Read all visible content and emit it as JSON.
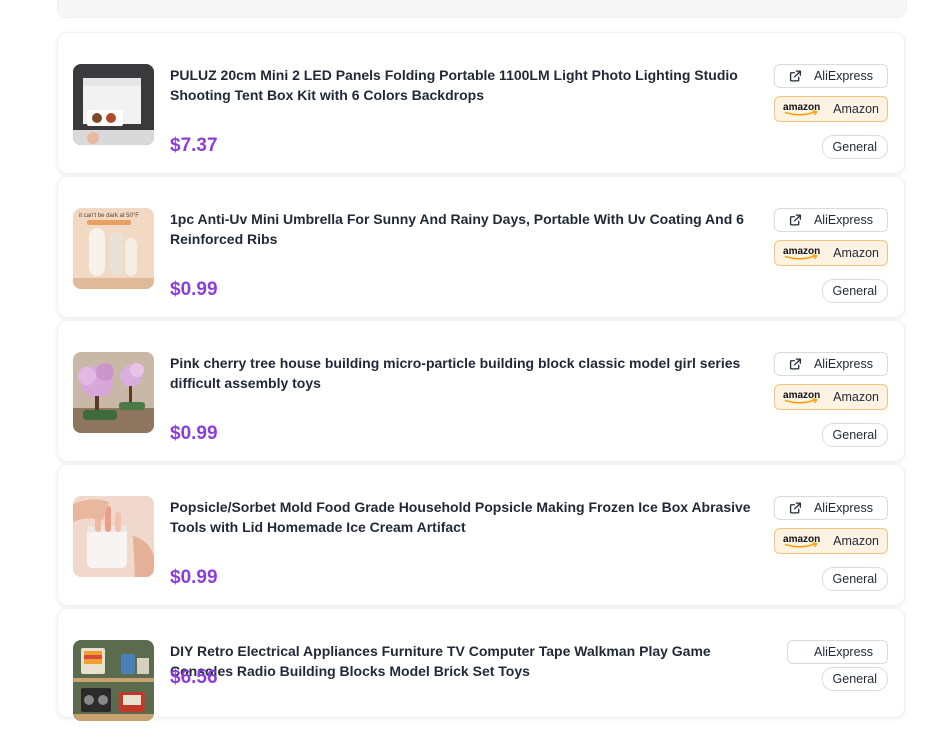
{
  "products": [
    {
      "title": "PULUZ 20cm Mini 2 LED Panels Folding Portable 1100LM Light Photo Lighting Studio Shooting Tent Box Kit with 6 Colors Backdrops",
      "price": "$7.37",
      "aliexpress_label": "AliExpress",
      "amazon_label": "Amazon",
      "amazon_logo": "amazon",
      "tag": "General"
    },
    {
      "title": "1pc Anti-Uv Mini Umbrella For Sunny And Rainy Days, Portable With Uv Coating And 6 Reinforced Ribs",
      "price": "$0.99",
      "thumb_text": "it can't be dark at 50°F",
      "aliexpress_label": "AliExpress",
      "amazon_label": "Amazon",
      "amazon_logo": "amazon",
      "tag": "General"
    },
    {
      "title": "Pink cherry tree house building micro-particle building block classic model girl series difficult assembly toys",
      "price": "$0.99",
      "aliexpress_label": "AliExpress",
      "amazon_label": "Amazon",
      "amazon_logo": "amazon",
      "tag": "General"
    },
    {
      "title": "Popsicle/Sorbet Mold Food Grade Household Popsicle Making Frozen Ice Box Abrasive Tools with Lid Homemade Ice Cream Artifact",
      "price": "$0.99",
      "aliexpress_label": "AliExpress",
      "amazon_label": "Amazon",
      "amazon_logo": "amazon",
      "tag": "General"
    },
    {
      "title": "DIY Retro Electrical Appliances Furniture TV Computer Tape Walkman Play Game Consoles Radio Building Blocks Model Brick Set Toys",
      "price": "$6.56",
      "aliexpress_label": "AliExpress",
      "tag": "General"
    }
  ],
  "icons": {
    "external_link": "external-link-icon",
    "amazon": "amazon-logo-icon"
  },
  "colors": {
    "price": "#8b3fd9",
    "amazon_bg": "#fff4e3",
    "amazon_border": "#f5c27a",
    "amazon_smile": "#ff9900"
  }
}
